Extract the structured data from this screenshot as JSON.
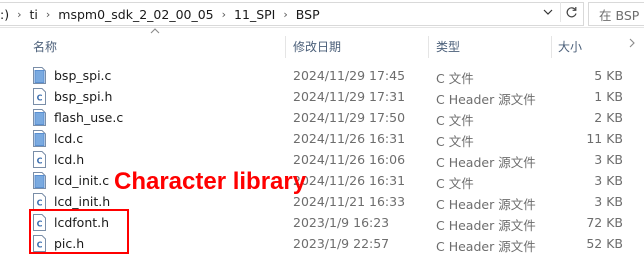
{
  "address_bar": {
    "crumbs": [
      ":)",
      "ti",
      "mspm0_sdk_2_02_00_05",
      "11_SPI",
      "BSP"
    ],
    "search_placeholder": "在 BSP 中"
  },
  "columns": {
    "name": "名称",
    "date": "修改日期",
    "type": "类型",
    "size": "大小"
  },
  "files": [
    {
      "name": "bsp_spi.c",
      "date": "2024/11/29 17:45",
      "type": "C 文件",
      "size": "5 KB",
      "icon": "c-source-file-icon"
    },
    {
      "name": "bsp_spi.h",
      "date": "2024/11/29 17:31",
      "type": "C Header 源文件",
      "size": "1 KB",
      "icon": "c-header-file-icon"
    },
    {
      "name": "flash_use.c",
      "date": "2024/11/29 17:50",
      "type": "C 文件",
      "size": "2 KB",
      "icon": "c-source-file-icon"
    },
    {
      "name": "lcd.c",
      "date": "2024/11/26 16:31",
      "type": "C 文件",
      "size": "11 KB",
      "icon": "c-source-file-icon"
    },
    {
      "name": "lcd.h",
      "date": "2024/11/26 16:06",
      "type": "C Header 源文件",
      "size": "3 KB",
      "icon": "c-header-file-icon"
    },
    {
      "name": "lcd_init.c",
      "date": "2024/11/26 16:31",
      "type": "C 文件",
      "size": "3 KB",
      "icon": "c-source-file-icon"
    },
    {
      "name": "lcd_init.h",
      "date": "2024/11/21 16:33",
      "type": "C Header 源文件",
      "size": "3 KB",
      "icon": "c-header-file-icon"
    },
    {
      "name": "lcdfont.h",
      "date": "2023/1/9 16:23",
      "type": "C Header 源文件",
      "size": "72 KB",
      "icon": "c-header-file-icon"
    },
    {
      "name": "pic.h",
      "date": "2023/1/9 22:57",
      "type": "C Header 源文件",
      "size": "52 KB",
      "icon": "c-header-file-icon"
    }
  ],
  "annotation": {
    "label": "Character library",
    "color": "#ff0000"
  },
  "colors": {
    "header_text": "#4c607a",
    "secondary_text": "#6d6d6d",
    "c_icon_blue": "#4a7fc1"
  }
}
